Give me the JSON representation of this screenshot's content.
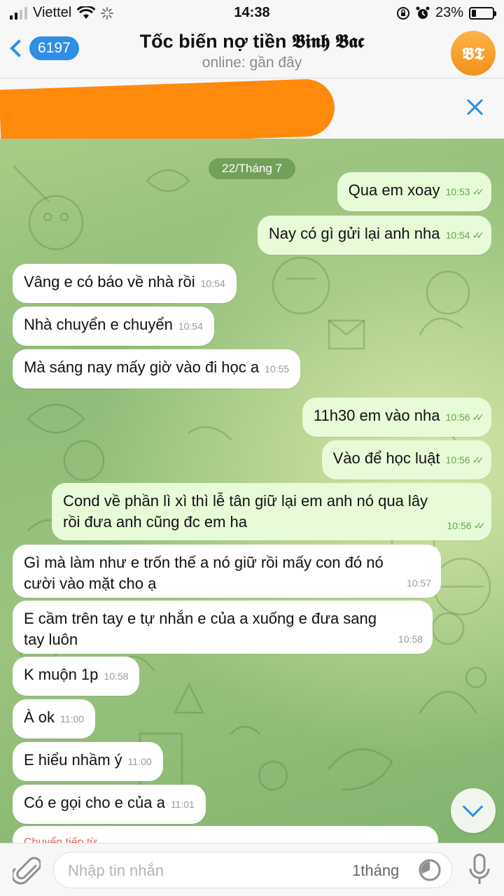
{
  "status": {
    "carrier": "Viettel",
    "time": "14:38",
    "battery": "23%",
    "battery_level": 0.23,
    "signal_bars": 2
  },
  "header": {
    "unread_count": "6197",
    "title": "Tốc biến nợ tiền 𝕭𝖎𝖓𝖍 𝕭𝖆𝖈",
    "subtitle": "online: gần đây",
    "avatar_initials": "𝕭𝕿"
  },
  "chat": {
    "date_label": "22/Tháng 7",
    "messages": [
      {
        "dir": "out",
        "text": "Qua em xoay",
        "time": "10:53"
      },
      {
        "dir": "out",
        "text": "Nay có gì gửi lại anh nha",
        "time": "10:54"
      },
      {
        "dir": "in",
        "text": "Vâng e có báo về nhà rồi",
        "time": "10:54"
      },
      {
        "dir": "in",
        "text": "Nhà chuyển e chuyển",
        "time": "10:54"
      },
      {
        "dir": "in",
        "text": "Mà sáng nay mấy giờ vào đi học a",
        "time": "10:55"
      },
      {
        "dir": "out",
        "text": "11h30 em vào nha",
        "time": "10:56"
      },
      {
        "dir": "out",
        "text": "Vào để học luật",
        "time": "10:56"
      },
      {
        "dir": "out",
        "line1": "Cond về phần lì xì thì lễ tân giữ lại em anh nó qua lây",
        "line2": "rồi đưa anh cũng đc em ha",
        "time": "10:56"
      },
      {
        "dir": "in",
        "line1": "Gì mà làm như e trốn thế a nó giữ rồi mấy con đó nó",
        "line2": "cười vào mặt cho ạ",
        "time": "10:57"
      },
      {
        "dir": "in",
        "line1": "E cầm trên tay e tự nhắn e của a xuống e đưa sang",
        "line2": "tay luôn",
        "time": "10:58"
      },
      {
        "dir": "in",
        "text": "K muộn 1p",
        "time": "10:58"
      },
      {
        "dir": "in",
        "text": "À ok",
        "time": "11:00"
      },
      {
        "dir": "in",
        "text": "E hiểu nhầm ý",
        "time": "11:00"
      },
      {
        "dir": "in",
        "text": "Có e gọi cho e của a",
        "time": "11:01"
      }
    ],
    "partial_forward_label": "Chuyển tiếp từ"
  },
  "input": {
    "placeholder": "Nhập tin nhắn",
    "timer_label": "1tháng"
  },
  "colors": {
    "accent": "#2f8ee6",
    "outgoing_bubble": "#e8fbd9",
    "incoming_bubble": "#ffffff",
    "chat_bg": "#9cc47f",
    "redaction": "#ff8a0c"
  }
}
